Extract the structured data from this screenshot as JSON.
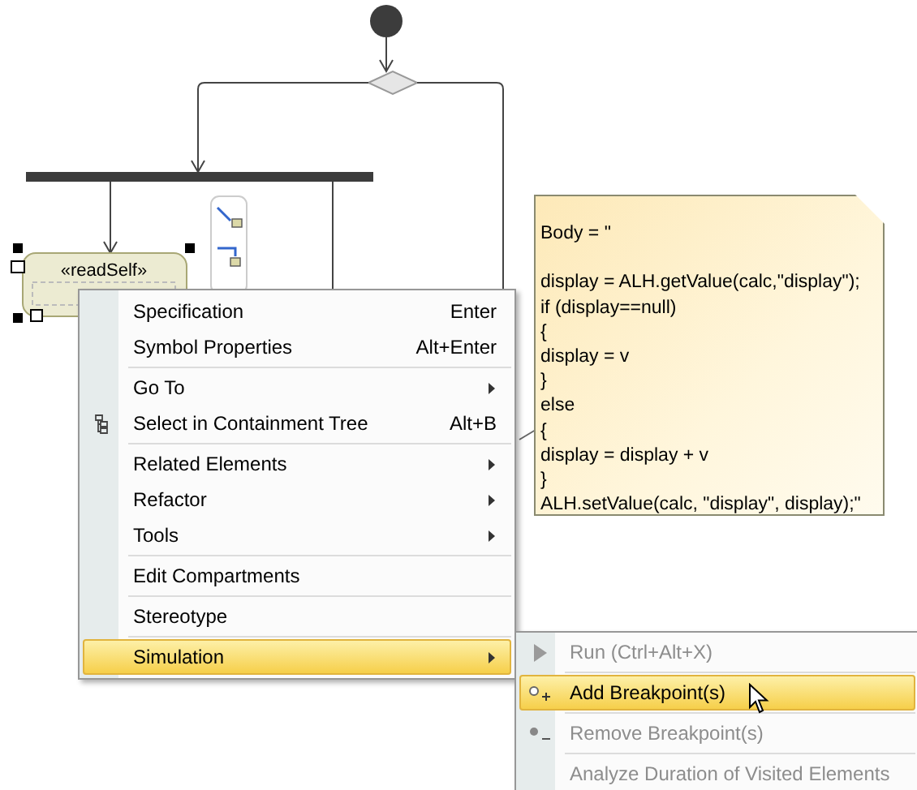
{
  "diagram": {
    "action": {
      "stereotype": "«readSelf»",
      "selected": true
    },
    "note": {
      "text": "Body = \"\n\ndisplay = ALH.getValue(calc,\"display\");\nif (display==null)\n{\ndisplay = v\n}\nelse\n{\ndisplay = display + v\n}\nALH.setValue(calc, \"display\", display);\""
    }
  },
  "context_menu": {
    "groups": [
      [
        {
          "label": "Specification",
          "shortcut": "Enter",
          "submenu": false,
          "icon": false,
          "selected": false
        },
        {
          "label": "Symbol Properties",
          "shortcut": "Alt+Enter",
          "submenu": false,
          "icon": false,
          "selected": false
        }
      ],
      [
        {
          "label": "Go To",
          "submenu": true,
          "icon": false,
          "selected": false
        },
        {
          "label": "Select in Containment Tree",
          "shortcut": "Alt+B",
          "submenu": false,
          "icon": true,
          "selected": false
        }
      ],
      [
        {
          "label": "Related Elements",
          "submenu": true,
          "icon": false,
          "selected": false
        },
        {
          "label": "Refactor",
          "submenu": true,
          "icon": false,
          "selected": false
        },
        {
          "label": "Tools",
          "submenu": true,
          "icon": false,
          "selected": false
        }
      ],
      [
        {
          "label": "Edit Compartments",
          "submenu": false,
          "icon": false,
          "selected": false
        }
      ],
      [
        {
          "label": "Stereotype",
          "submenu": false,
          "icon": false,
          "selected": false
        }
      ],
      [
        {
          "label": "Simulation",
          "submenu": true,
          "icon": false,
          "selected": true
        }
      ]
    ]
  },
  "submenu": {
    "items": [
      {
        "label": "Run (Ctrl+Alt+X)",
        "kind": "run",
        "disabled": true,
        "selected": false
      },
      {
        "label": "Add Breakpoint(s)",
        "kind": "add",
        "disabled": false,
        "selected": true
      },
      {
        "label": "Remove Breakpoint(s)",
        "kind": "remove",
        "disabled": true,
        "selected": false
      },
      {
        "label": "Analyze Duration of Visited Elements",
        "kind": "plain",
        "disabled": true,
        "selected": false
      }
    ]
  }
}
